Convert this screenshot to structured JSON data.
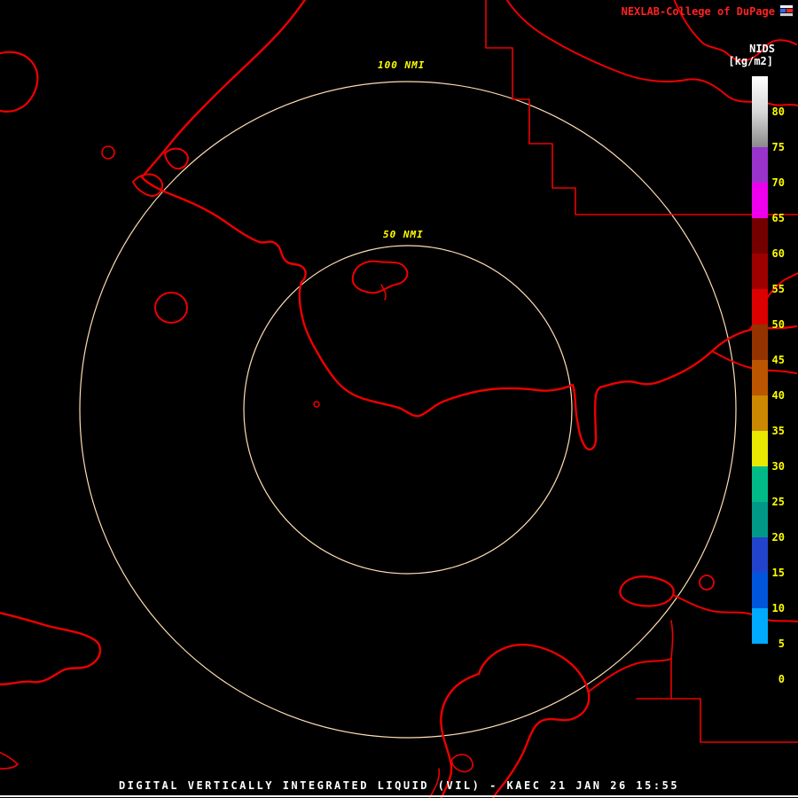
{
  "header": {
    "brand": "NEXLAB-College of DuPage",
    "logo_icon": "cod-logo-icon"
  },
  "legend": {
    "title": "NIDS",
    "units": "[kg/m2]",
    "ticks": [
      "80",
      "75",
      "70",
      "65",
      "60",
      "55",
      "50",
      "45",
      "40",
      "35",
      "30",
      "25",
      "20",
      "15",
      "10",
      "5",
      "0"
    ],
    "colors": [
      "linear-gradient(#ffffff,#d8d8d8)",
      "linear-gradient(#d8d8d8,#8a8a8a)",
      "#9933cc",
      "#ee00ee",
      "#750000",
      "#9e0000",
      "#dd0000",
      "#953300",
      "#bb5500",
      "#cc8800",
      "#e8e800",
      "#00bb88",
      "#009988",
      "#2244cc",
      "#0055dd",
      "#00aaff",
      "#000000",
      "#000000"
    ],
    "tick_color": "#ffff00"
  },
  "map": {
    "range_rings": [
      {
        "label": "100 NMI"
      },
      {
        "label": "50 NMI"
      }
    ],
    "ring_color": "#ffddb3",
    "outline_color": "#ee0000",
    "label_color": "#ffff00",
    "background": "#000000"
  },
  "footer": {
    "title": "DIGITAL VERTICALLY INTEGRATED LIQUID (VIL) - KAEC 21 JAN 26 15:55"
  }
}
